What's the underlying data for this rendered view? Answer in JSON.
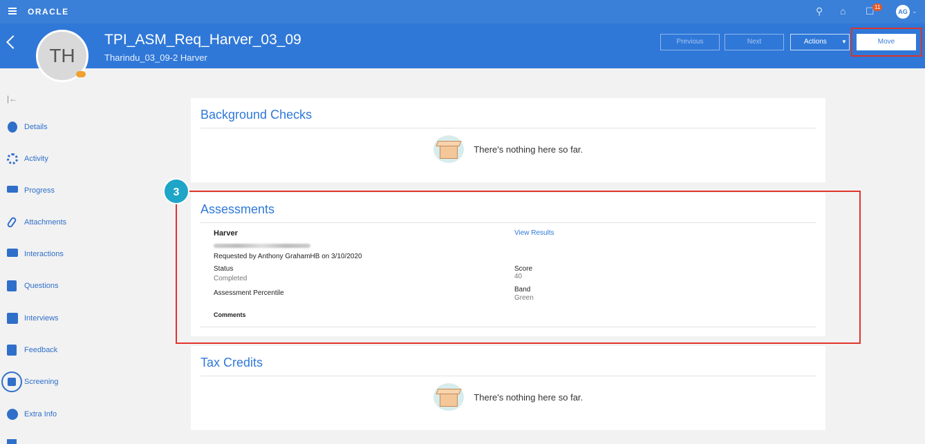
{
  "topbar": {
    "logo": "ORACLE",
    "notification_count": "11",
    "user_initials": "AG",
    "icons": [
      "menu-icon",
      "search-icon",
      "home-icon",
      "notifications-icon",
      "avatar",
      "chevron-down-icon"
    ]
  },
  "header": {
    "title": "TPI_ASM_Req_Harver_03_09",
    "subtitle": "Tharindu_03_09-2 Harver",
    "avatar_initials": "TH",
    "buttons": {
      "previous": "Previous",
      "next": "Next",
      "actions": "Actions",
      "move": "Move"
    }
  },
  "sidebar": {
    "items": [
      {
        "label": "Details",
        "icon": "person-icon"
      },
      {
        "label": "Activity",
        "icon": "activity-icon"
      },
      {
        "label": "Progress",
        "icon": "progress-icon"
      },
      {
        "label": "Attachments",
        "icon": "paperclip-icon"
      },
      {
        "label": "Interactions",
        "icon": "interactions-icon"
      },
      {
        "label": "Questions",
        "icon": "questions-icon"
      },
      {
        "label": "Interviews",
        "icon": "calendar-icon"
      },
      {
        "label": "Feedback",
        "icon": "feedback-icon"
      },
      {
        "label": "Screening",
        "icon": "screening-icon"
      },
      {
        "label": "Extra Info",
        "icon": "info-icon"
      }
    ]
  },
  "background_checks": {
    "title": "Background Checks",
    "empty_text": "There's nothing here so far."
  },
  "assessments": {
    "title": "Assessments",
    "step_number": "3",
    "provider": "Harver",
    "view_results": "View Results",
    "requested_by": "Requested by Anthony GrahamHB on 3/10/2020",
    "status_label": "Status",
    "status_value": "Completed",
    "score_label": "Score",
    "score_value": "40",
    "percentile_label": "Assessment Percentile",
    "band_label": "Band",
    "band_value": "Green",
    "comments_label": "Comments"
  },
  "tax_credits": {
    "title": "Tax Credits",
    "empty_text": "There's nothing here so far."
  },
  "colors": {
    "brand_blue": "#2f78d8",
    "highlight_red": "#e0342b",
    "step_teal": "#1ea5c8"
  }
}
